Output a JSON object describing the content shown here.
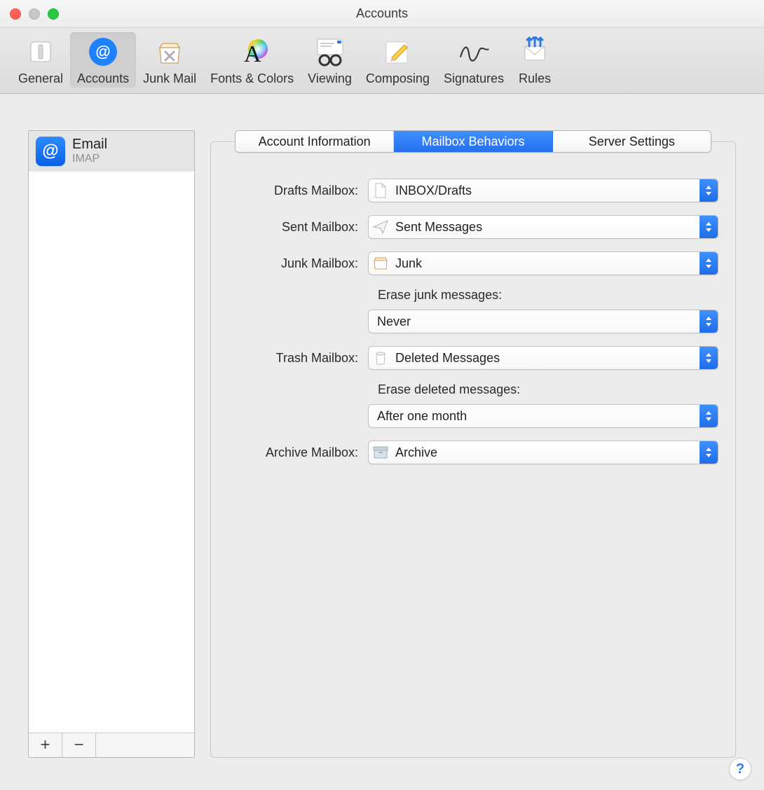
{
  "window": {
    "title": "Accounts"
  },
  "toolbar": {
    "items": [
      {
        "label": "General"
      },
      {
        "label": "Accounts"
      },
      {
        "label": "Junk Mail"
      },
      {
        "label": "Fonts & Colors"
      },
      {
        "label": "Viewing"
      },
      {
        "label": "Composing"
      },
      {
        "label": "Signatures"
      },
      {
        "label": "Rules"
      }
    ]
  },
  "sidebar": {
    "accounts": [
      {
        "name": "Email",
        "type": "IMAP"
      }
    ],
    "add": "+",
    "remove": "−"
  },
  "tabs": {
    "items": [
      {
        "label": "Account Information"
      },
      {
        "label": "Mailbox Behaviors"
      },
      {
        "label": "Server Settings"
      }
    ],
    "active_index": 1
  },
  "form": {
    "drafts": {
      "label": "Drafts Mailbox:",
      "value": "INBOX/Drafts"
    },
    "sent": {
      "label": "Sent Mailbox:",
      "value": "Sent Messages"
    },
    "junk": {
      "label": "Junk Mailbox:",
      "value": "Junk"
    },
    "erase_junk_label": "Erase junk messages:",
    "erase_junk": {
      "value": "Never"
    },
    "trash": {
      "label": "Trash Mailbox:",
      "value": "Deleted Messages"
    },
    "erase_deleted_label": "Erase deleted messages:",
    "erase_deleted": {
      "value": "After one month"
    },
    "archive": {
      "label": "Archive Mailbox:",
      "value": "Archive"
    }
  },
  "help": "?"
}
